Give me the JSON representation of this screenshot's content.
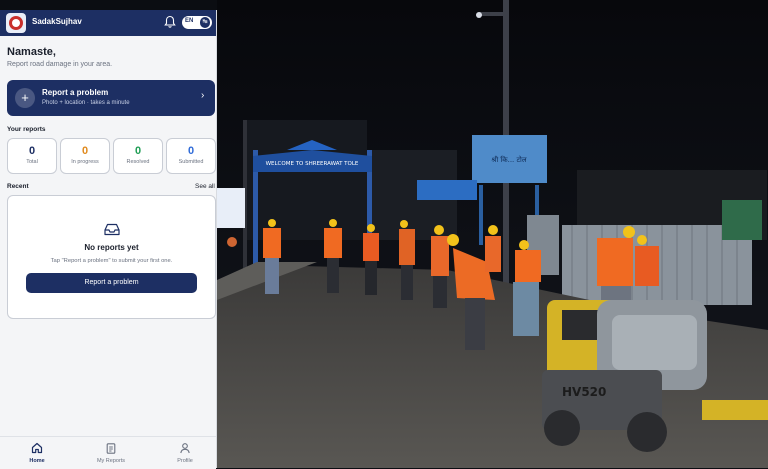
{
  "app": {
    "name": "SadakSujhav",
    "lang": "EN"
  },
  "greeting": {
    "title": "Namaste,",
    "subtitle": "Report road damage in your area."
  },
  "cta": {
    "title": "Report a problem",
    "subtitle": "Photo + location · takes a minute"
  },
  "reports": {
    "heading": "Your reports",
    "stats": [
      {
        "value": "0",
        "label": "Total",
        "color": "#1d2f63"
      },
      {
        "value": "0",
        "label": "In progress",
        "color": "#e08a1e"
      },
      {
        "value": "0",
        "label": "Resolved",
        "color": "#1f9e55"
      },
      {
        "value": "0",
        "label": "Submitted",
        "color": "#2f6bd8"
      }
    ]
  },
  "recent": {
    "heading": "Recent",
    "see_all": "See all",
    "empty_title": "No reports yet",
    "empty_text": "Tap \"Report a problem\" to submit your first one.",
    "button": "Report a problem"
  },
  "tabs": [
    {
      "label": "Home",
      "icon": "home-icon"
    },
    {
      "label": "My Reports",
      "icon": "clipboard-icon"
    },
    {
      "label": "Profile",
      "icon": "user-icon"
    }
  ],
  "photo": {
    "arch_sign": "WELCOME TO SHREERAWAT TOLE",
    "tower_sign": "श्री कि... टोल",
    "roller_model": "HV520"
  },
  "colors": {
    "brand": "#1d2f63",
    "background": "#f4f5f7"
  }
}
